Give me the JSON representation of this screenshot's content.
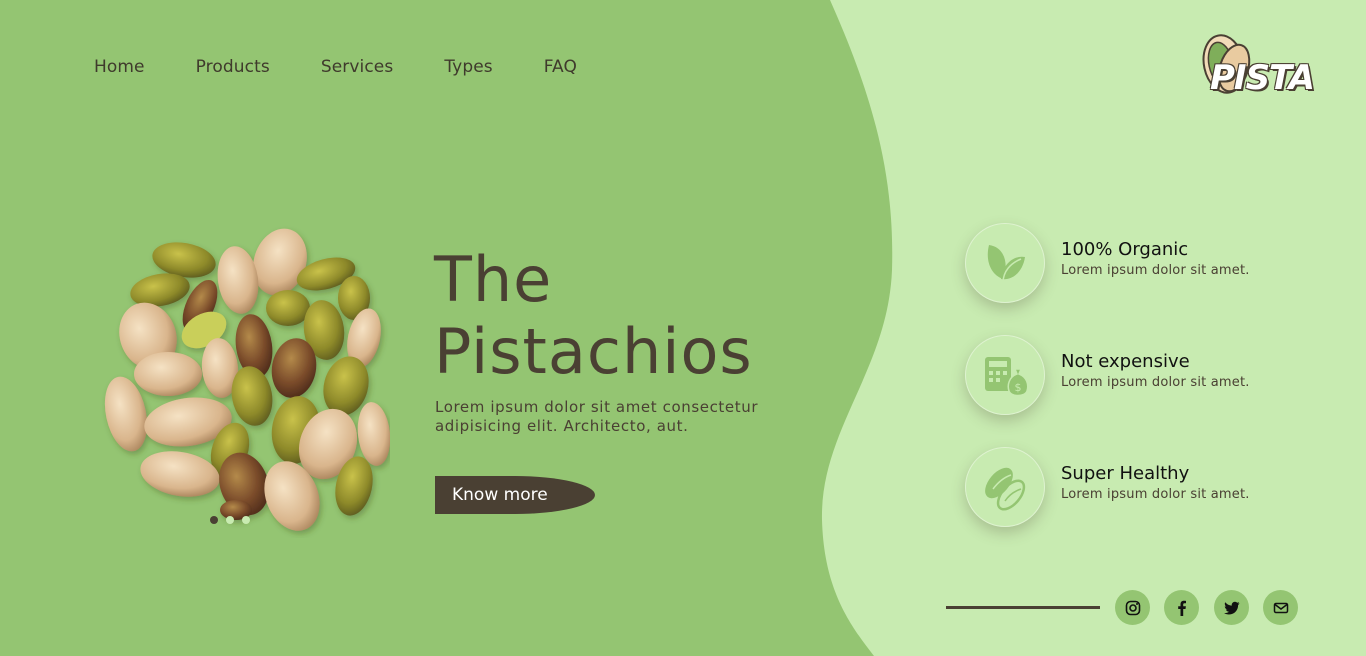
{
  "nav": {
    "items": [
      {
        "label": "Home"
      },
      {
        "label": "Products"
      },
      {
        "label": "Services"
      },
      {
        "label": "Types"
      },
      {
        "label": "FAQ"
      }
    ]
  },
  "logo": {
    "text": "PISTA"
  },
  "hero": {
    "title_line1": "The",
    "title_line2": "Pistachios",
    "desc_line1": "Lorem ipsum dolor sit amet consectetur",
    "desc_line2": "adipisicing elit. Architecto, aut.",
    "cta_label": "Know more"
  },
  "carousel": {
    "dots": 3,
    "active": 1
  },
  "features": [
    {
      "icon": "leaf-icon",
      "title": "100% Organic",
      "desc": "Lorem ipsum dolor sit amet."
    },
    {
      "icon": "money-icon",
      "title": "Not expensive",
      "desc": "Lorem ipsum dolor sit amet."
    },
    {
      "icon": "pistachio-icon",
      "title": "Super Healthy",
      "desc": "Lorem ipsum dolor sit amet."
    }
  ],
  "social": [
    {
      "icon": "instagram-icon"
    },
    {
      "icon": "facebook-icon"
    },
    {
      "icon": "twitter-icon"
    },
    {
      "icon": "mail-icon"
    }
  ],
  "colors": {
    "main_green": "#94c572",
    "light_green": "#c8ebb1",
    "dark_brown": "#4a4033"
  }
}
